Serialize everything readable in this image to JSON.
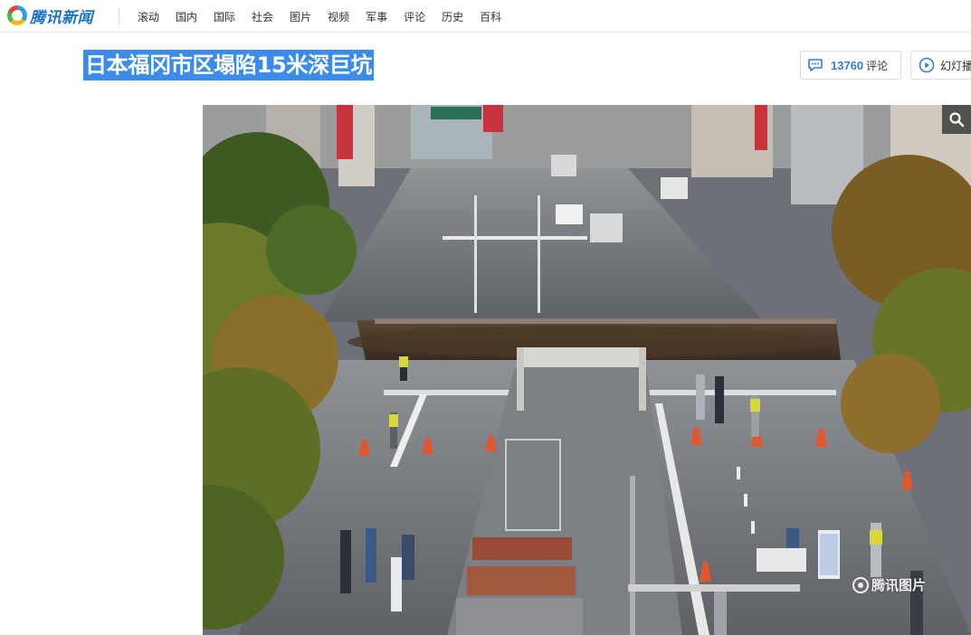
{
  "site": {
    "logo_text": "腾讯新闻",
    "logo_icon": "tencent-news-logo-icon",
    "brand_colors": {
      "blue": "#1a71c9",
      "orange": "#f6b417",
      "green": "#52b74a",
      "red": "#e8422d"
    }
  },
  "nav": {
    "items": [
      {
        "label": "滚动"
      },
      {
        "label": "国内"
      },
      {
        "label": "国际"
      },
      {
        "label": "社会"
      },
      {
        "label": "图片"
      },
      {
        "label": "视频"
      },
      {
        "label": "军事"
      },
      {
        "label": "评论"
      },
      {
        "label": "历史"
      },
      {
        "label": "百科"
      }
    ]
  },
  "article": {
    "title": "日本福冈市区塌陷15米深巨坑",
    "title_highlight_color": "#3b8bea",
    "comments": {
      "count": "13760",
      "label": "评论",
      "icon": "comment-icon",
      "accent": "#2f7fd0"
    },
    "slideshow": {
      "label": "幻灯播",
      "icon": "play-circle-icon"
    }
  },
  "photo": {
    "zoom_icon": "search-icon",
    "watermark_text": "腾讯图片"
  }
}
